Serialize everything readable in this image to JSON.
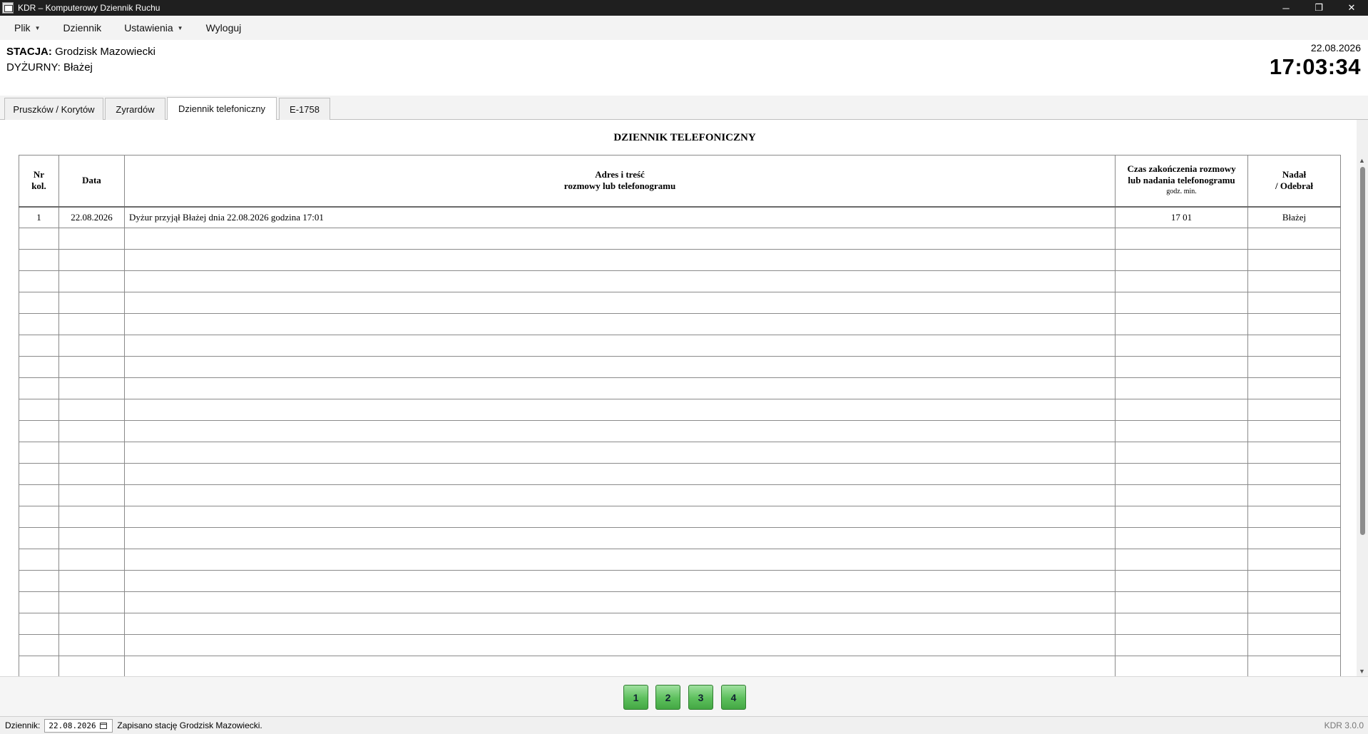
{
  "window": {
    "title": "KDR – Komputerowy Dziennik Ruchu",
    "minimize": "─",
    "restore": "❐",
    "close": "✕"
  },
  "menu": {
    "items": [
      {
        "label": "Plik",
        "dropdown": true
      },
      {
        "label": "Dziennik",
        "dropdown": false
      },
      {
        "label": "Ustawienia",
        "dropdown": true
      },
      {
        "label": "Wyloguj",
        "dropdown": false
      }
    ],
    "caret": "▼"
  },
  "header": {
    "station_label": "STACJA:",
    "station_value": "Grodzisk Mazowiecki",
    "duty_label": "DYŻURNY:",
    "duty_value": "Błażej",
    "date": "22.08.2026",
    "time": "17:03:34"
  },
  "tabs": [
    {
      "label": "Pruszków / Korytów",
      "active": false
    },
    {
      "label": "Zyrardów",
      "active": false
    },
    {
      "label": "Dziennik telefoniczny",
      "active": true
    },
    {
      "label": "E-1758",
      "active": false
    }
  ],
  "journal": {
    "title": "DZIENNIK TELEFONICZNY",
    "columns": {
      "nr_line1": "Nr",
      "nr_line2": "kol.",
      "date": "Data",
      "address_line1": "Adres i treść",
      "address_line2": "rozmowy lub telefonogramu",
      "time_line1": "Czas zakończenia rozmowy",
      "time_line2": "lub nadania telefonogramu",
      "time_units": "godz.    min.",
      "who_line1": "Nadał",
      "who_line2": "/ Odebrał"
    },
    "rows": [
      {
        "nr": "1",
        "date": "22.08.2026",
        "text": "Dyżur przyjął Błażej dnia 22.08.2026 godzina 17:01",
        "time": "17 01",
        "who": "Błażej"
      }
    ],
    "empty_rows": 21
  },
  "pager": {
    "pages": [
      "1",
      "2",
      "3",
      "4"
    ]
  },
  "status": {
    "label": "Dziennik:",
    "date_value": "22.08.2026",
    "date_display": "22.08.2026",
    "message": "Zapisano stację Grodzisk Mazowiecki.",
    "version": "KDR 3.0.0"
  },
  "colors": {
    "titlebar": "#1f1f1f",
    "page_button": "#5cbf5c"
  }
}
